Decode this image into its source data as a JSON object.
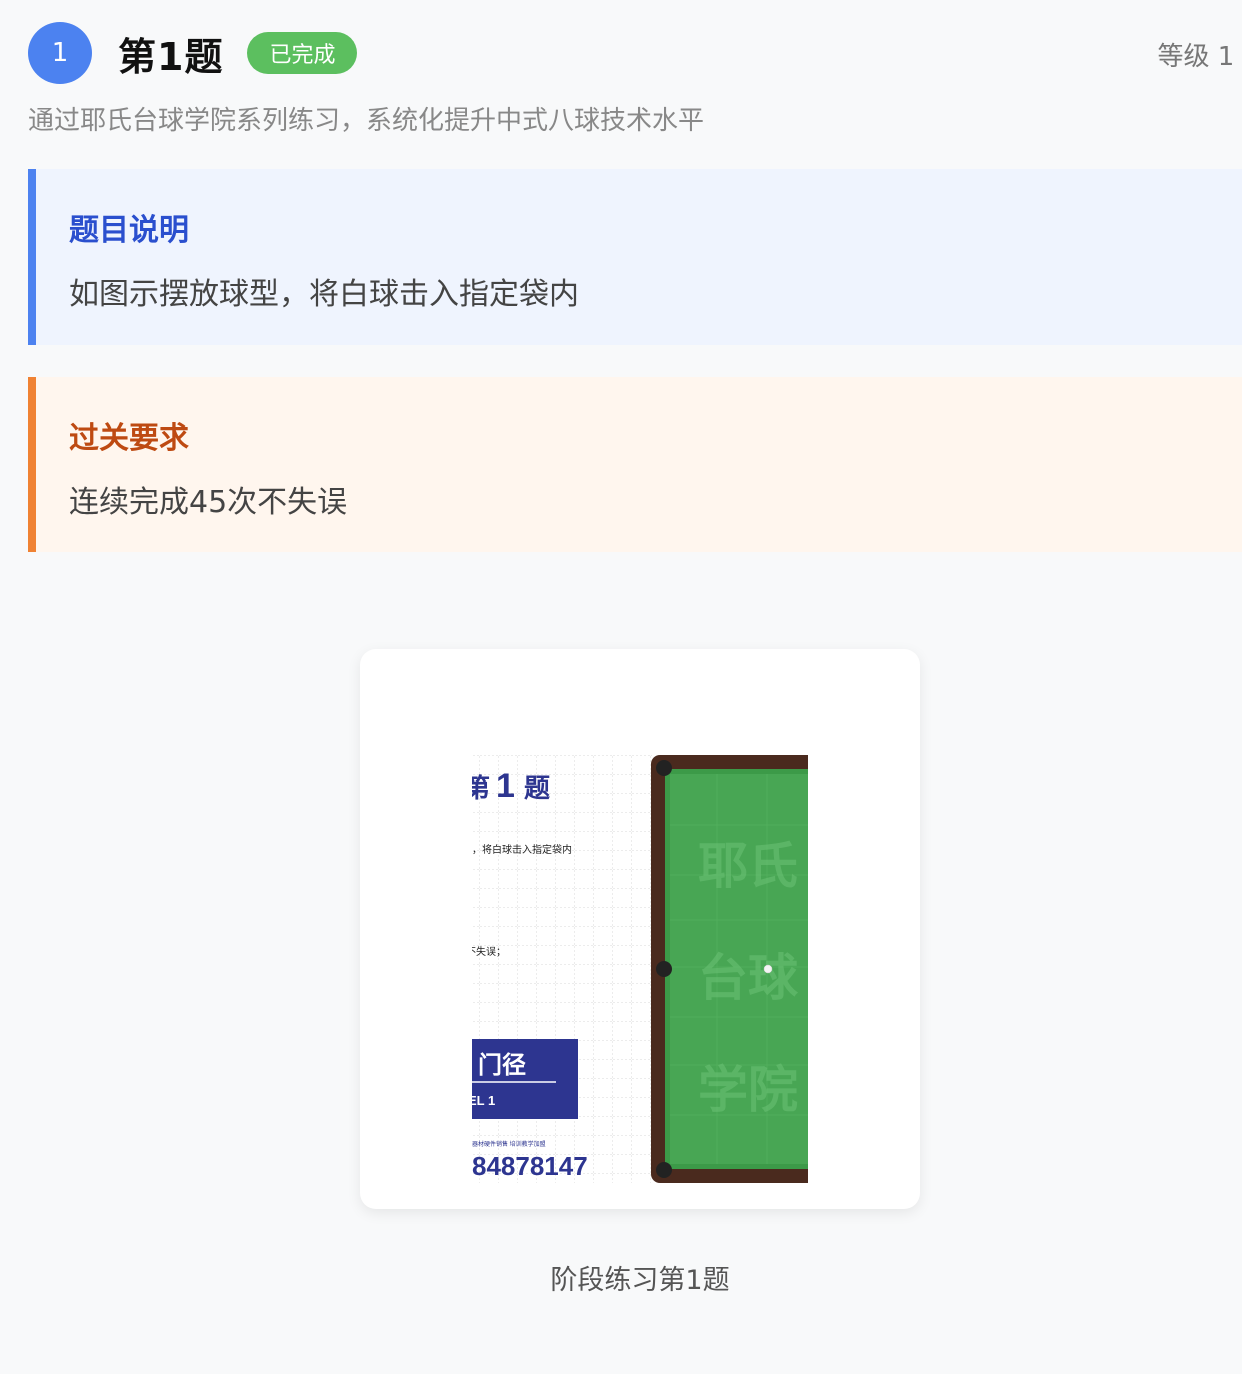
{
  "header": {
    "number": "1",
    "title": "第1题",
    "status_badge": "已完成",
    "level": "等级 1 -"
  },
  "subtitle": "通过耶氏台球学院系列练习，系统化提升中式八球技术水平",
  "description": {
    "heading": "题目说明",
    "text": "如图示摆放球型，将白球击入指定袋内"
  },
  "requirement": {
    "heading": "过关要求",
    "text": "连续完成45次不失误"
  },
  "image_card": {
    "sheet_title": "1",
    "sheet_title_suffix": "题",
    "sheet_title_prefix": "第",
    "sheet_line1": "，将白球击入指定袋内",
    "sheet_line2": "不失误；",
    "banner_title": "门径",
    "banner_sub": "EL 1",
    "small_text": "器材硬件销售 培训教学加盟",
    "phone": "84878147",
    "watermark": [
      "耶氏",
      "台球",
      "学院"
    ]
  },
  "caption": "阶段练习第1题",
  "colors": {
    "accent_blue": "#4c82f0",
    "success_green": "#5cbf5f",
    "warning_orange": "#f08233",
    "navy": "#2d3590",
    "felt_green": "#3c9a48",
    "rail_brown": "#4a2a1e"
  }
}
